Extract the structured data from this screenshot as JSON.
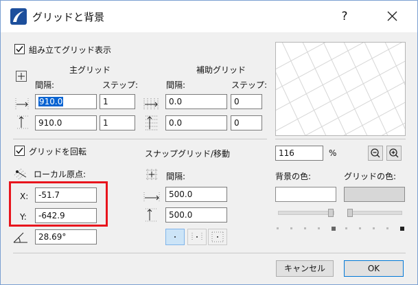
{
  "title": "グリッドと背景",
  "help_label": "?",
  "assembly_grid": {
    "label": "組み立てグリッド表示",
    "checked": true
  },
  "main_grid": {
    "header": "主グリッド",
    "spacing_label": "間隔:",
    "step_label": "ステップ:",
    "x_spacing": "910.0",
    "x_step": "1",
    "y_spacing": "910.0",
    "y_step": "1"
  },
  "aux_grid": {
    "header": "補助グリッド",
    "spacing_label": "間隔:",
    "step_label": "ステップ:",
    "x_spacing": "0.0",
    "x_step": "0",
    "y_spacing": "0.0",
    "y_step": "0"
  },
  "rotate_grid": {
    "label": "グリッドを回転",
    "checked": true,
    "local_origin_label": "ローカル原点:",
    "x_label": "X:",
    "x_value": "-51.7",
    "y_label": "Y:",
    "y_value": "-642.9",
    "angle_value": "28.69°"
  },
  "snap_grid": {
    "header": "スナップグリッド/移動",
    "spacing_label": "間隔:",
    "x_spacing": "500.0",
    "y_spacing": "500.0"
  },
  "zoom": {
    "value": "116",
    "unit": "%"
  },
  "colors": {
    "background_label": "背景の色:",
    "grid_label": "グリッドの色:",
    "background_hex": "#ffffff",
    "grid_hex": "#d7d7d7",
    "highlight_hex": "#e8141c",
    "accent_hex": "#0a64d2"
  },
  "buttons": {
    "cancel": "キャンセル",
    "ok": "OK"
  }
}
